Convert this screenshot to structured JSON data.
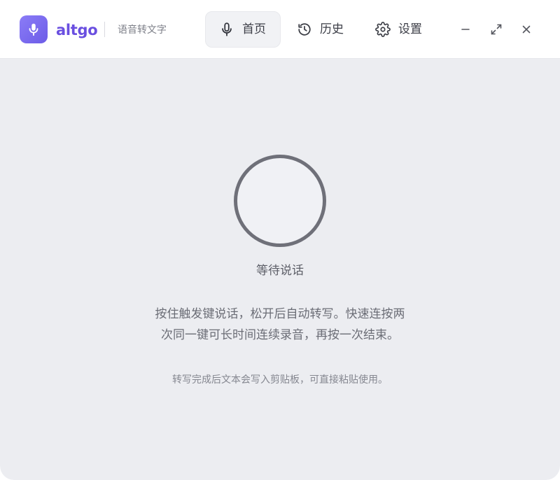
{
  "app": {
    "brand": "altgo",
    "subtitle": "语音转文字",
    "accent_color": "#6a4fe0"
  },
  "nav": {
    "tabs": [
      {
        "label": "首页",
        "icon": "microphone-icon",
        "active": true
      },
      {
        "label": "历史",
        "icon": "history-icon",
        "active": false
      },
      {
        "label": "设置",
        "icon": "gear-icon",
        "active": false
      }
    ]
  },
  "window_controls": [
    "minimize-icon",
    "maximize-icon",
    "close-icon"
  ],
  "main": {
    "status": "等待说话",
    "instruction_line1": "按住触发键说话，松开后自动转写。快速连按两",
    "instruction_line2": "次同一键可长时间连续录音，再按一次结束。",
    "hint": "转写完成后文本会写入剪贴板，可直接粘贴使用。"
  }
}
